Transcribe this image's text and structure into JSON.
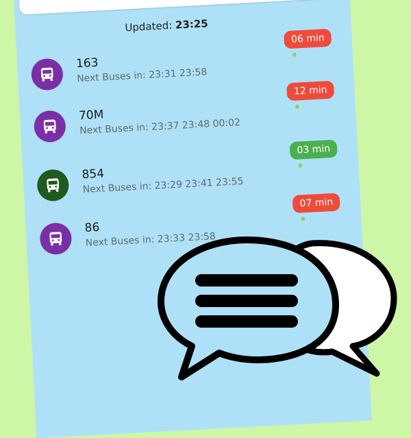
{
  "updated": {
    "label": "Updated:",
    "time": "23:25"
  },
  "buses": [
    {
      "number": "163",
      "next": "Next Buses in: 23:31 23:58",
      "eta": "06 min",
      "eta_status": "late",
      "icon_color": "#7b2fa6"
    },
    {
      "number": "70M",
      "next": "Next Buses in: 23:37 23:48 00:02",
      "eta": "12 min",
      "eta_status": "late",
      "icon_color": "#7b2fa6"
    },
    {
      "number": "854",
      "next": "Next Buses in: 23:29 23:41 23:55",
      "eta": "03 min",
      "eta_status": "on-time",
      "icon_color": "#1f5a1f"
    },
    {
      "number": "86",
      "next": "Next Buses in: 23:33 23:58",
      "eta": "07 min",
      "eta_status": "late",
      "icon_color": "#7b2fa6"
    }
  ],
  "colors": {
    "background": "#cdf6a7",
    "screen": "#aee1f7",
    "late": "#ef4a3a",
    "on_time": "#4caf50"
  },
  "icons": {
    "bus": "bus-icon",
    "chat": "chat-bubbles-icon"
  }
}
